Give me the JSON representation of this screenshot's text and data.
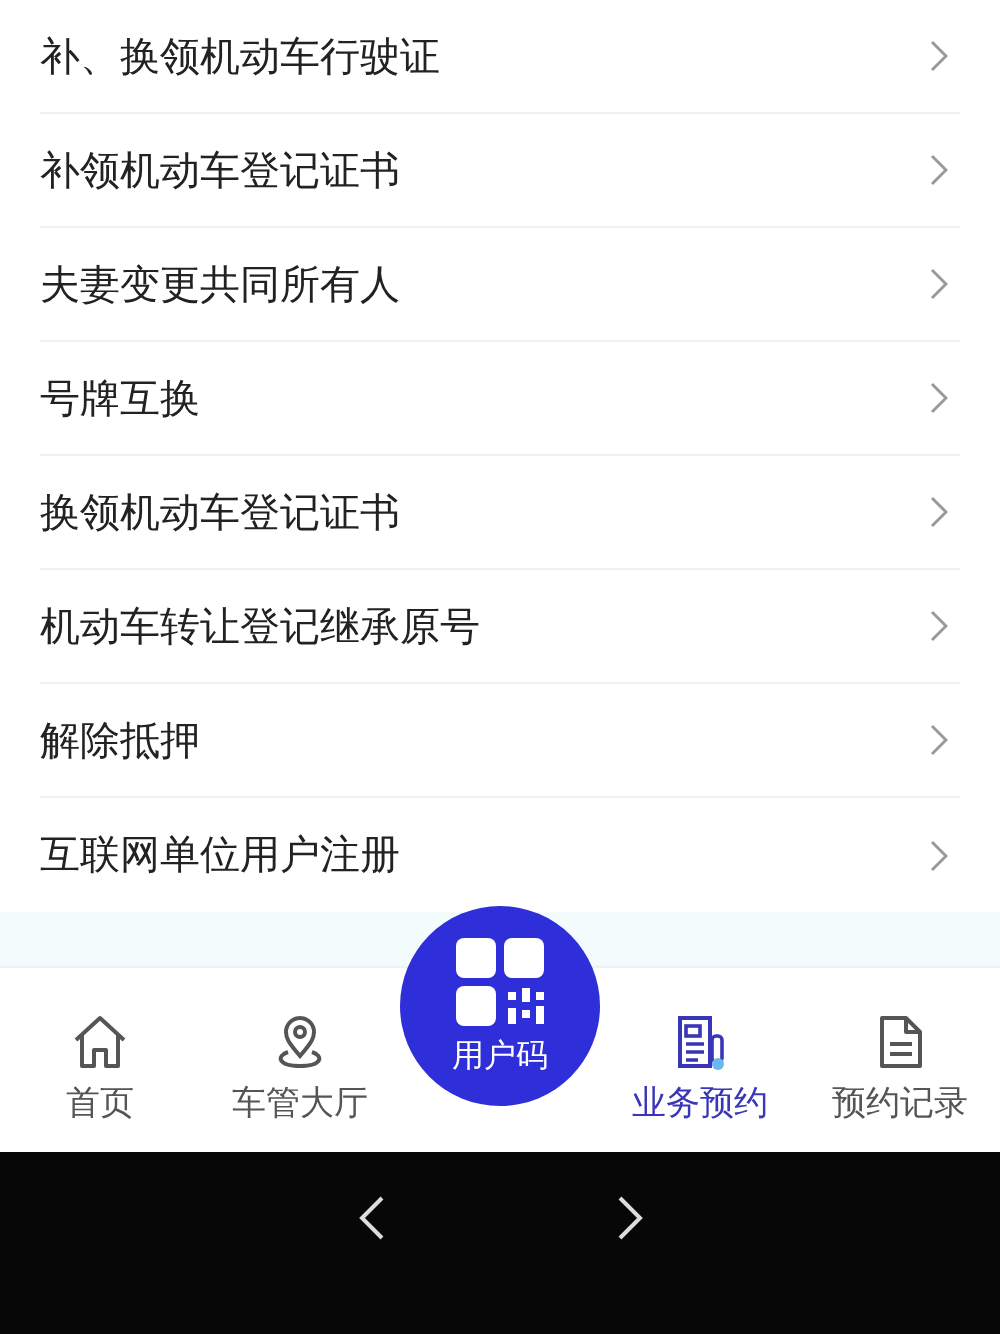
{
  "services": [
    {
      "label": "补、换领机动车行驶证"
    },
    {
      "label": "补领机动车登记证书"
    },
    {
      "label": "夫妻变更共同所有人"
    },
    {
      "label": "号牌互换"
    },
    {
      "label": "换领机动车登记证书"
    },
    {
      "label": "机动车转让登记继承原号"
    },
    {
      "label": "解除抵押"
    },
    {
      "label": "互联网单位用户注册"
    }
  ],
  "tab_bar": [
    {
      "kind": "home",
      "label": "首页",
      "selected": false
    },
    {
      "kind": "location",
      "label": "车管大厅",
      "selected": false
    },
    {
      "kind": "code",
      "label": "用户码",
      "selected": false
    },
    {
      "kind": "booking",
      "label": "业务预约",
      "selected": true
    },
    {
      "kind": "records",
      "label": "预约记录",
      "selected": false
    }
  ]
}
